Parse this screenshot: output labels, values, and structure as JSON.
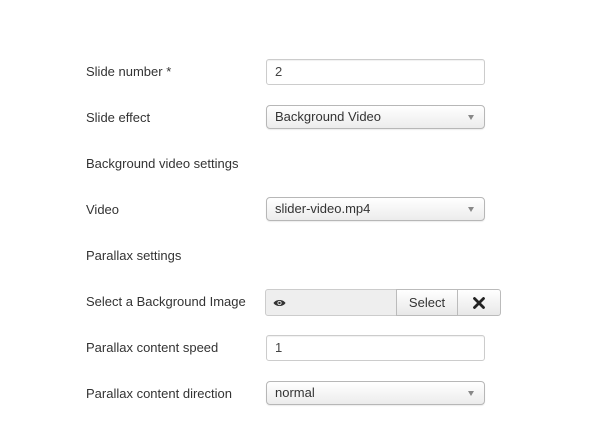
{
  "form": {
    "slide_number": {
      "label": "Slide number *",
      "value": "2"
    },
    "slide_effect": {
      "label": "Slide effect",
      "selected": "Background Video"
    },
    "background_video_section": {
      "label": "Background video settings"
    },
    "video": {
      "label": "Video",
      "selected": "slider-video.mp4"
    },
    "parallax_section": {
      "label": "Parallax settings"
    },
    "background_image": {
      "label": "Select a Background Image",
      "value": "",
      "preview_icon": "eye-icon",
      "select_label": "Select",
      "clear_icon": "close-icon"
    },
    "parallax_speed": {
      "label": "Parallax content speed",
      "value": "1"
    },
    "parallax_direction": {
      "label": "Parallax content direction",
      "selected": "normal"
    }
  }
}
